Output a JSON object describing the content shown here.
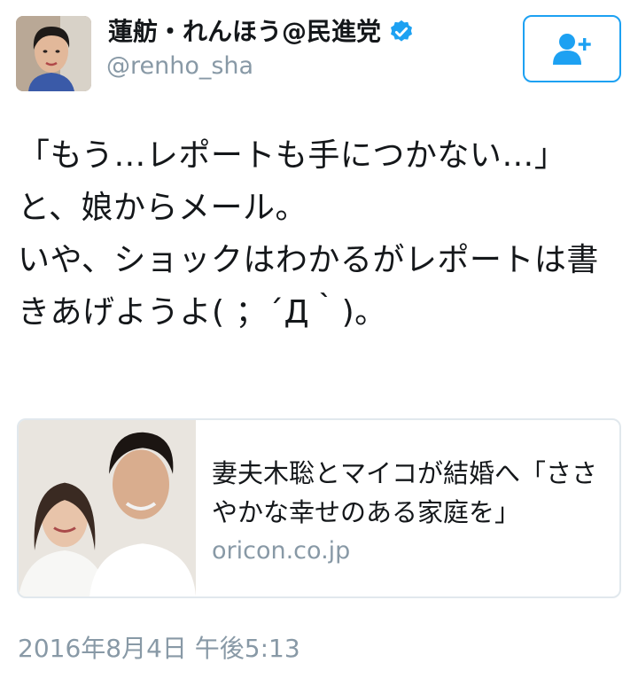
{
  "author": {
    "display_name": "蓮舫・れんほう@民進党",
    "handle": "@renho_sha",
    "verified_icon": "verified-badge-icon",
    "avatar_icon": "avatar"
  },
  "follow_button": {
    "icon": "follow-user-plus-icon",
    "color": "#1da1f2"
  },
  "tweet": {
    "text": "「もう…レポートも手につかない…」\nと、娘からメール。\nいや、ショックはわかるがレポートは書きあげようよ( ；´Д｀)。"
  },
  "card": {
    "title": "妻夫木聡とマイコが結婚へ「ささやかな幸せのある家庭を」",
    "domain": "oricon.co.jp"
  },
  "timestamp": "2016年8月4日 午後5:13",
  "colors": {
    "accent": "#1da1f2",
    "secondary_text": "#8899a6",
    "border": "#e1e8ed"
  }
}
